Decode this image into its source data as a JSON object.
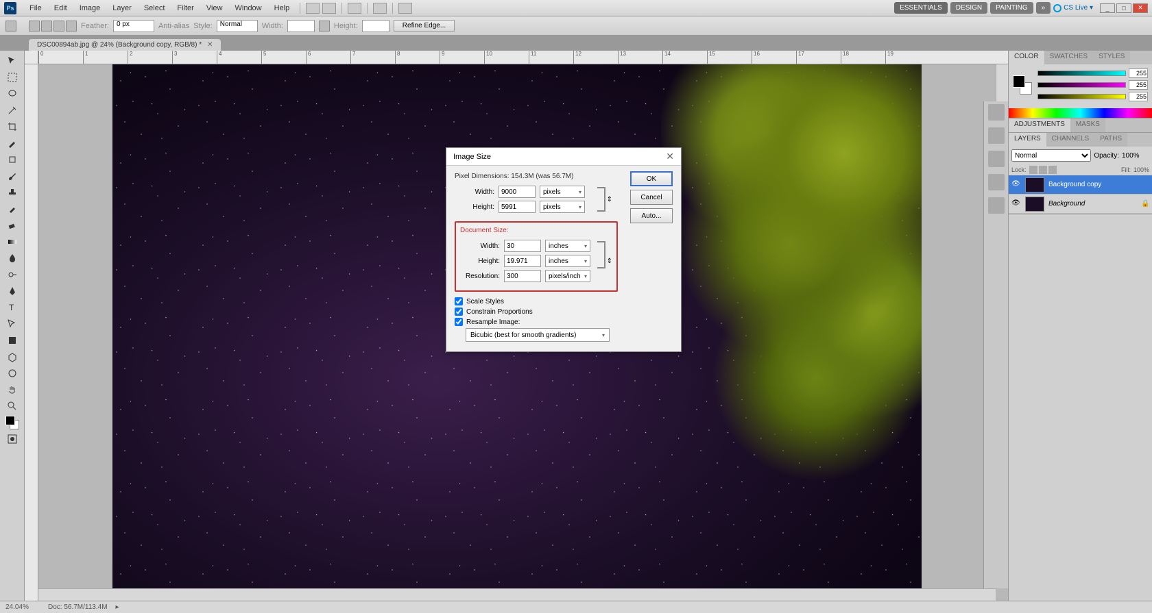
{
  "app": {
    "logo": "Ps"
  },
  "menu": [
    "File",
    "Edit",
    "Image",
    "Layer",
    "Select",
    "Filter",
    "View",
    "Window",
    "Help"
  ],
  "workspace_buttons": [
    "ESSENTIALS",
    "DESIGN",
    "PAINTING",
    "»"
  ],
  "cslive": "CS Live ▾",
  "options": {
    "feather_label": "Feather:",
    "feather_value": "0 px",
    "antialias": "Anti-alias",
    "style_label": "Style:",
    "style_value": "Normal",
    "width_label": "Width:",
    "height_label": "Height:",
    "refine": "Refine Edge..."
  },
  "doc_tab": "DSC00894ab.jpg @ 24% (Background copy, RGB/8) *",
  "ruler_ticks": [
    "0",
    "1",
    "2",
    "3",
    "4",
    "5",
    "6",
    "7",
    "8",
    "9",
    "10",
    "11",
    "12",
    "13",
    "14",
    "15",
    "16",
    "17",
    "18",
    "19"
  ],
  "dialog": {
    "title": "Image Size",
    "pixel_dim_label": "Pixel Dimensions:",
    "pixel_dim_value": "154.3M (was 56.7M)",
    "px_width_label": "Width:",
    "px_width_value": "9000",
    "px_width_unit": "pixels",
    "px_height_label": "Height:",
    "px_height_value": "5991",
    "px_height_unit": "pixels",
    "doc_size_label": "Document Size:",
    "doc_width_label": "Width:",
    "doc_width_value": "30",
    "doc_width_unit": "inches",
    "doc_height_label": "Height:",
    "doc_height_value": "19.971",
    "doc_height_unit": "inches",
    "res_label": "Resolution:",
    "res_value": "300",
    "res_unit": "pixels/inch",
    "scale_styles": "Scale Styles",
    "constrain": "Constrain Proportions",
    "resample": "Resample Image:",
    "resample_method": "Bicubic (best for smooth gradients)",
    "ok": "OK",
    "cancel": "Cancel",
    "auto": "Auto..."
  },
  "panels": {
    "color": {
      "tabs": [
        "COLOR",
        "SWATCHES",
        "STYLES"
      ],
      "r": "255",
      "g": "255",
      "b": "255"
    },
    "adjustments": {
      "tabs": [
        "ADJUSTMENTS",
        "MASKS"
      ]
    },
    "layers": {
      "tabs": [
        "LAYERS",
        "CHANNELS",
        "PATHS"
      ],
      "blend": "Normal",
      "opacity_label": "Opacity:",
      "opacity": "100%",
      "lock_label": "Lock:",
      "fill_label": "Fill:",
      "fill": "100%",
      "items": [
        {
          "name": "Background copy",
          "selected": true,
          "locked": false
        },
        {
          "name": "Background",
          "selected": false,
          "locked": true
        }
      ]
    }
  },
  "status": {
    "zoom": "24.04%",
    "doc": "Doc: 56.7M/113.4M"
  }
}
